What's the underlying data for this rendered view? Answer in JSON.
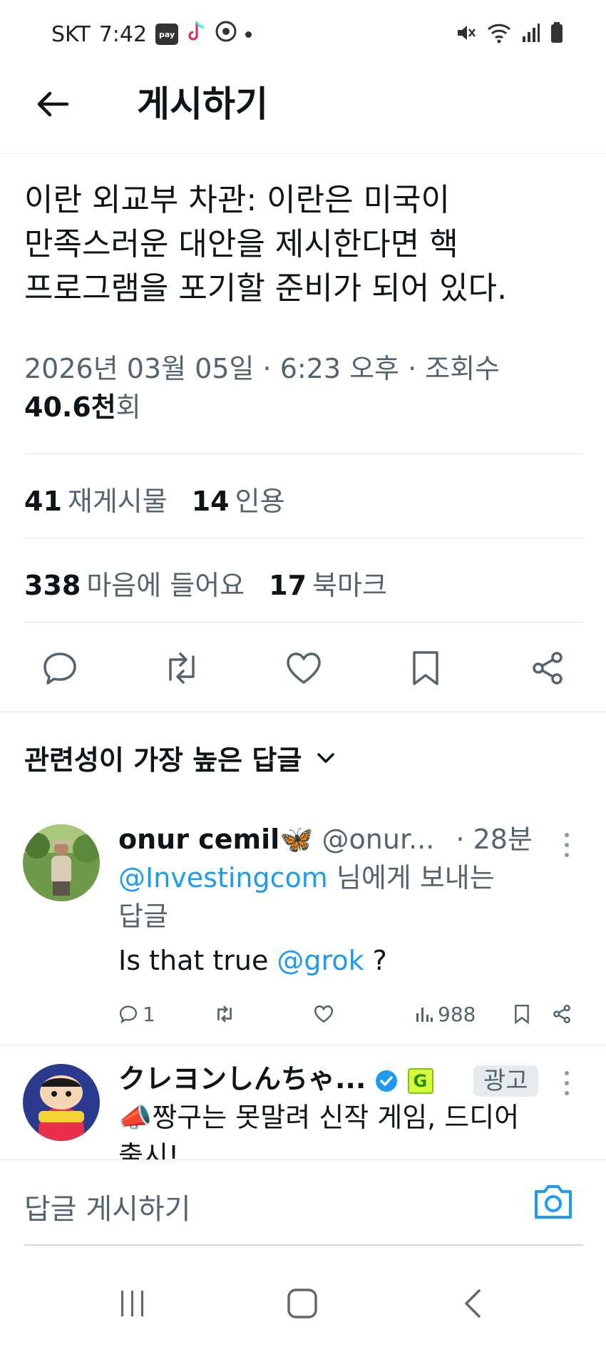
{
  "status_bar": {
    "carrier": "SKT",
    "time": "7:42",
    "pay_label": "pay"
  },
  "header": {
    "title": "게시하기"
  },
  "post": {
    "text_lines": [
      "이란 외교부 차관: 이란은 미국이",
      "만족스러운 대안을 제시한다면 핵",
      "프로그램을 포기할 준비가 되어 있다."
    ],
    "meta_line": "2026년 03월 05일 · 6:23 오후 · 조회수",
    "views_value": "40.6천",
    "views_unit": "회",
    "reposts_count": "41",
    "reposts_label": "재게시물",
    "quotes_count": "14",
    "quotes_label": "인용",
    "likes_count": "338",
    "likes_label": "마음에 들어요",
    "bookmarks_count": "17",
    "bookmarks_label": "북마크"
  },
  "sort": {
    "label": "관련성이 가장 높은 답글"
  },
  "replies": [
    {
      "name": "onur cemil🦋",
      "handle": "@onur...",
      "time": "· 28분",
      "reply_to_handle": "@Investingcom",
      "reply_to_suffix": " 님에게 보내는",
      "reply_to_line2": "답글",
      "text_prefix": "Is that true ",
      "text_mention": "@grok",
      "text_suffix": " ?",
      "reply_count": "1",
      "views": "988"
    },
    {
      "name": "クレヨンしんちゃ...",
      "badge_g": "G",
      "ad_label": "광고",
      "text_line1": "📣짱구는 못말려 신작 게임, 드디어",
      "text_line2": "출시!"
    }
  ],
  "composer": {
    "placeholder": "답글 게시하기"
  },
  "colors": {
    "accent": "#1d9bf0",
    "text": "#0f1419",
    "secondary": "#536471"
  }
}
